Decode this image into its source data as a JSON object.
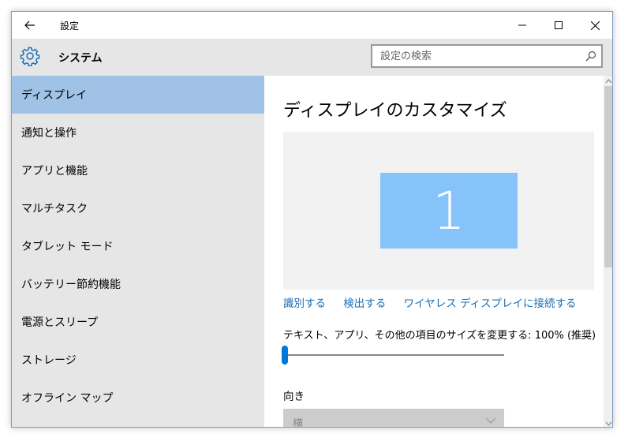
{
  "window": {
    "title": "設定",
    "accent": "#a0c2e6",
    "link_color": "#1a6fb5"
  },
  "header": {
    "title": "システム",
    "icon": "gear-icon",
    "search": {
      "placeholder": "設定の検索",
      "value": ""
    }
  },
  "sidebar": {
    "items": [
      {
        "label": "ディスプレイ",
        "selected": true
      },
      {
        "label": "通知と操作"
      },
      {
        "label": "アプリと機能"
      },
      {
        "label": "マルチタスク"
      },
      {
        "label": "タブレット モード"
      },
      {
        "label": "バッテリー節約機能"
      },
      {
        "label": "電源とスリープ"
      },
      {
        "label": "ストレージ"
      },
      {
        "label": "オフライン マップ"
      }
    ]
  },
  "main": {
    "title": "ディスプレイのカスタマイズ",
    "monitor_number": "1",
    "monitor_color": "#87c3fb",
    "links": {
      "identify": "識別する",
      "detect": "検出する",
      "wireless": "ワイヤレス ディスプレイに接続する"
    },
    "scale": {
      "label": "テキスト、アプリ、その他の項目のサイズを変更する: 100% (推奨)",
      "value": 0
    },
    "orientation": {
      "label": "向き",
      "value": "横"
    }
  }
}
